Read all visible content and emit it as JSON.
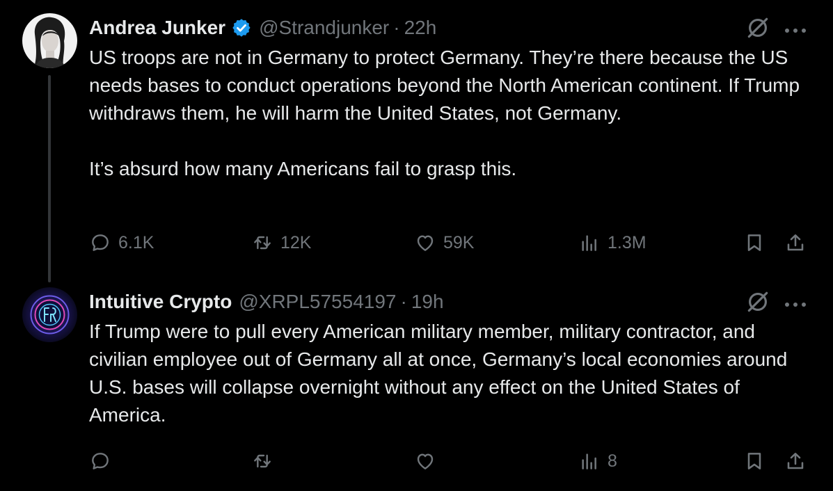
{
  "colors": {
    "background": "#000000",
    "text_primary": "#e7e9ea",
    "text_secondary": "#71767b",
    "verified_blue": "#1d9bf0",
    "thread_line": "#333639"
  },
  "tweets": [
    {
      "author_name": "Andrea Junker",
      "verified": true,
      "handle": "@Strandjunker",
      "separator": "·",
      "time": "22h",
      "paragraphs": [
        "US troops are not in Germany to protect Germany. They’re there because the US needs bases to conduct operations beyond the North American continent. If Trump withdraws them, he will harm the United States, not Germany.",
        "It’s absurd how many Americans fail to grasp this."
      ],
      "stats": {
        "replies": "6.1K",
        "reposts": "12K",
        "likes": "59K",
        "views": "1.3M"
      },
      "icons": [
        "grok-icon",
        "more-icon",
        "reply-icon",
        "retweet-icon",
        "like-icon",
        "views-icon",
        "bookmark-icon",
        "share-icon"
      ]
    },
    {
      "author_name": "Intuitive Crypto",
      "verified": false,
      "handle": "@XRPL57554197",
      "separator": "·",
      "time": "19h",
      "paragraphs": [
        "If Trump were to pull every American military member, military contractor, and civilian employee out of Germany all at once, Germany’s local economies around U.S. bases will collapse overnight without any effect on the United States of America."
      ],
      "stats": {
        "views": "8"
      },
      "icons": [
        "grok-icon",
        "more-icon",
        "reply-icon",
        "retweet-icon",
        "like-icon",
        "views-icon",
        "bookmark-icon",
        "share-icon"
      ]
    }
  ]
}
